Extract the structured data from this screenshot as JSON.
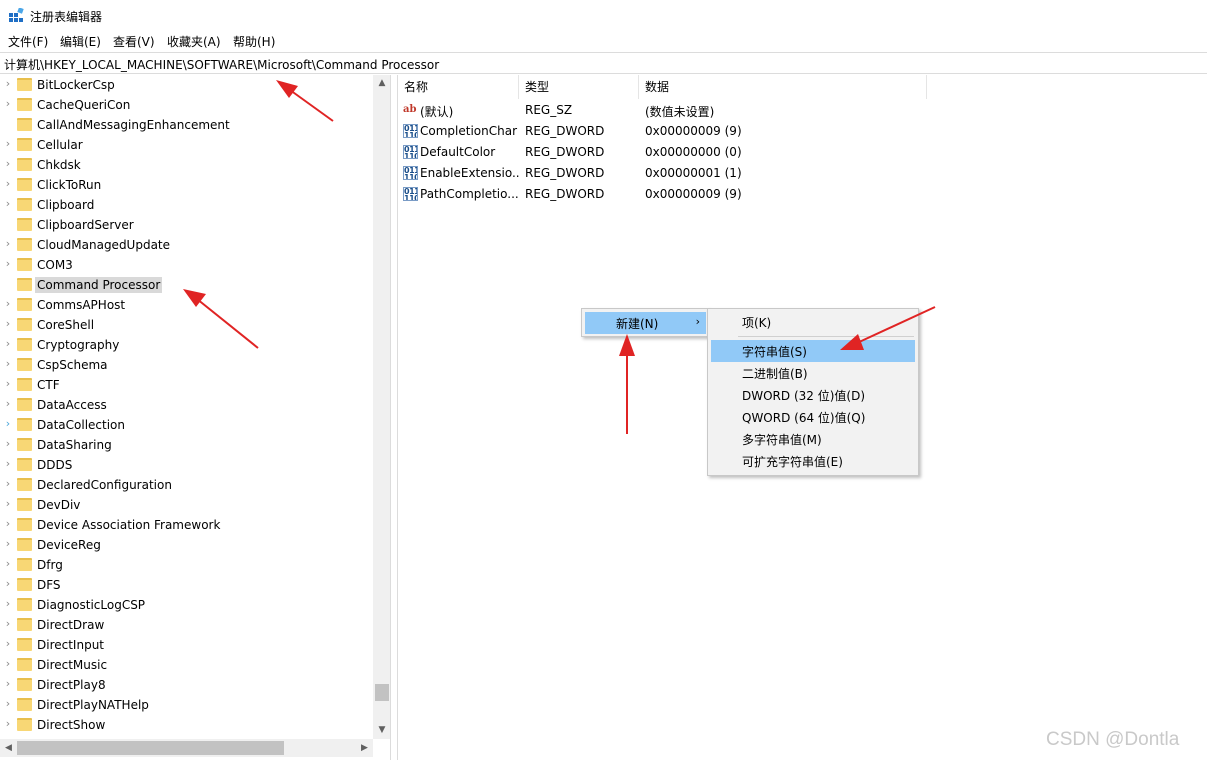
{
  "window": {
    "title": "注册表编辑器",
    "icon": "regedit-icon"
  },
  "menubar": [
    "文件(F)",
    "编辑(E)",
    "查看(V)",
    "收藏夹(A)",
    "帮助(H)"
  ],
  "address": "计算机\\HKEY_LOCAL_MACHINE\\SOFTWARE\\Microsoft\\Command Processor",
  "tree": {
    "selected": "Command Processor",
    "items": [
      "BitLockerCsp",
      "CacheQueriCon",
      "CallAndMessagingEnhancement",
      "Cellular",
      "Chkdsk",
      "ClickToRun",
      "Clipboard",
      "ClipboardServer",
      "CloudManagedUpdate",
      "COM3",
      "Command Processor",
      "CommsAPHost",
      "CoreShell",
      "Cryptography",
      "CspSchema",
      "CTF",
      "DataAccess",
      "DataCollection",
      "DataSharing",
      "DDDS",
      "DeclaredConfiguration",
      "DevDiv",
      "Device Association Framework",
      "DeviceReg",
      "Dfrg",
      "DFS",
      "DiagnosticLogCSP",
      "DirectDraw",
      "DirectInput",
      "DirectMusic",
      "DirectPlay8",
      "DirectPlayNATHelp",
      "DirectShow"
    ]
  },
  "values": {
    "headers": {
      "name": "名称",
      "type": "类型",
      "data": "数据"
    },
    "rows": [
      {
        "name": "(默认)",
        "type": "REG_SZ",
        "data": "(数值未设置)",
        "icon": "string-value-icon"
      },
      {
        "name": "CompletionChar",
        "type": "REG_DWORD",
        "data": "0x00000009 (9)",
        "icon": "dword-value-icon"
      },
      {
        "name": "DefaultColor",
        "type": "REG_DWORD",
        "data": "0x00000000 (0)",
        "icon": "dword-value-icon"
      },
      {
        "name": "EnableExtensio...",
        "type": "REG_DWORD",
        "data": "0x00000001 (1)",
        "icon": "dword-value-icon"
      },
      {
        "name": "PathCompletio...",
        "type": "REG_DWORD",
        "data": "0x00000009 (9)",
        "icon": "dword-value-icon"
      }
    ]
  },
  "context_menu": {
    "main_label": "新建(N)",
    "submenu": [
      "项(K)",
      "字符串值(S)",
      "二进制值(B)",
      "DWORD (32 位)值(D)",
      "QWORD (64 位)值(Q)",
      "多字符串值(M)",
      "可扩充字符串值(E)"
    ],
    "highlighted": "字符串值(S)"
  },
  "watermark": "CSDN @Dontla",
  "colors": {
    "highlight": "#91c9f7",
    "selected_tree": "#d9d9d9",
    "annotation_arrow": "#e02424",
    "folder": "#f8d775"
  }
}
